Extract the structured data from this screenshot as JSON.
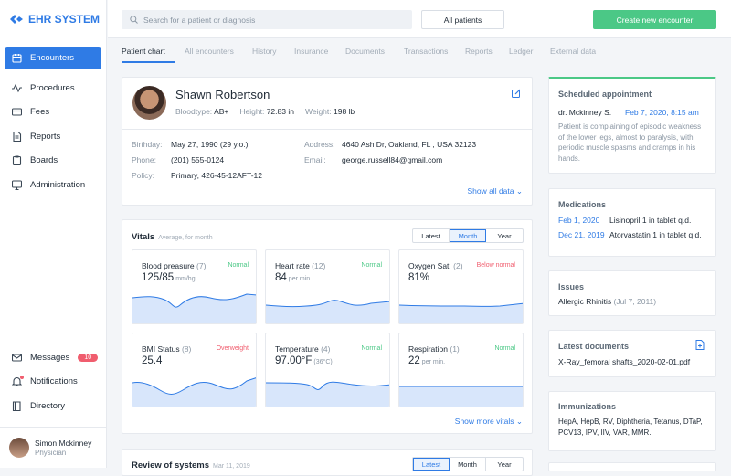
{
  "app": {
    "title": "EHR SYSTEM"
  },
  "sidebar": {
    "items": [
      {
        "label": "Encounters",
        "icon": "calendar-icon"
      },
      {
        "label": "Procedures",
        "icon": "pulse-icon"
      },
      {
        "label": "Fees",
        "icon": "card-icon"
      },
      {
        "label": "Reports",
        "icon": "document-icon"
      },
      {
        "label": "Boards",
        "icon": "clipboard-icon"
      },
      {
        "label": "Administration",
        "icon": "monitor-icon"
      }
    ],
    "bottom": [
      {
        "label": "Messages",
        "badge": "10",
        "icon": "mail-icon"
      },
      {
        "label": "Notifications",
        "icon": "bell-icon"
      },
      {
        "label": "Directory",
        "icon": "book-icon"
      }
    ],
    "user": {
      "name": "Simon Mckinney",
      "role": "Physician"
    }
  },
  "topbar": {
    "search_placeholder": "Search for a patient or diagnosis",
    "filter": "All patients",
    "create": "Create new encounter"
  },
  "tabs": [
    "Patient chart",
    "All encounters",
    "History",
    "Insurance",
    "Documents",
    "Transactions",
    "Reports",
    "Ledger",
    "External data"
  ],
  "patient": {
    "name": "Shawn Robertson",
    "bloodtype_label": "Bloodtype:",
    "bloodtype": "AB+",
    "height_label": "Height:",
    "height": "72.83 in",
    "weight_label": "Weight:",
    "weight": "198 lb",
    "birthday_label": "Birthday:",
    "birthday": "May 27, 1990 (29 y.o.)",
    "phone_label": "Phone:",
    "phone": "(201) 555-0124",
    "policy_label": "Policy:",
    "policy": "Primary, 426-45-12AFT-12",
    "address_label": "Address:",
    "address": "4640 Ash Dr, Oakland, FL , USA 32123",
    "email_label": "Email:",
    "email": "george.russell84@gmail.com",
    "show_all": "Show all data"
  },
  "vitals": {
    "title": "Vitals",
    "subtitle": "Average, for month",
    "periods": [
      "Latest",
      "Month",
      "Year"
    ],
    "cards": [
      {
        "name": "Blood preasure",
        "count": "(7)",
        "status": "Normal",
        "value": "125/85",
        "unit": "mm/hg"
      },
      {
        "name": "Heart rate",
        "count": "(12)",
        "status": "Normal",
        "value": "84",
        "unit": "per min."
      },
      {
        "name": "Oxygen Sat.",
        "count": "(2)",
        "status": "Below normal",
        "value": "81%",
        "unit": ""
      },
      {
        "name": "BMI Status",
        "count": "(8)",
        "status": "Overweight",
        "value": "25.4",
        "unit": ""
      },
      {
        "name": "Temperature",
        "count": "(4)",
        "status": "Normal",
        "value": "97.00°F",
        "unit": "(36°C)"
      },
      {
        "name": "Respiration",
        "count": "(1)",
        "status": "Normal",
        "value": "22",
        "unit": "per min."
      }
    ],
    "show_more": "Show more vitals"
  },
  "ros": {
    "title": "Review of systems",
    "date": "Mar 11, 2019",
    "periods": [
      "Latest",
      "Month",
      "Year"
    ]
  },
  "appointment": {
    "title": "Scheduled appointment",
    "doctor": "dr. Mckinney S.",
    "date": "Feb 7, 2020, 8:15 am",
    "note": "Patient is complaining of episodic weakness of the lower legs, almost to paralysis, with periodic muscle spasms and cramps in his hands."
  },
  "medications": {
    "title": "Medications",
    "items": [
      {
        "date": "Feb 1, 2020",
        "name": "Lisinopril 1 in tablet q.d."
      },
      {
        "date": "Dec 21, 2019",
        "name": "Atorvastatin 1 in tablet q.d."
      }
    ]
  },
  "issues": {
    "title": "Issues",
    "name": "Allergic Rhinitis",
    "date": "(Jul 7, 2011)"
  },
  "documents": {
    "title": "Latest documents",
    "file": "X-Ray_femoral shafts_2020-02-01.pdf"
  },
  "immunizations": {
    "title": "Immunizations",
    "list": "HepA, HepB, RV, Diphtheria, Tetanus, DTaP, PCV13, IPV, IIV, VAR, MMR."
  },
  "colors": {
    "accent": "#2f7be5",
    "create": "#4bc886",
    "normal": "#4bc886",
    "alert": "#f05d6e"
  }
}
